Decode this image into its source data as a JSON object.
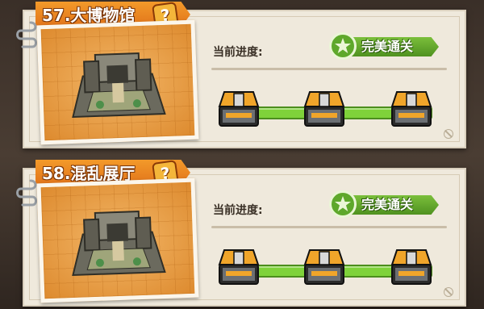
{
  "levels": [
    {
      "title": "57.大博物馆",
      "help_symbol": "?",
      "progress_label": "当前进度:",
      "status_badge": "完美通关",
      "chests": [
        "chest-1",
        "chest-2",
        "chest-3"
      ],
      "progress": 1.0
    },
    {
      "title": "58.混乱展厅",
      "help_symbol": "?",
      "progress_label": "当前进度:",
      "status_badge": "完美通关",
      "chests": [
        "chest-1",
        "chest-2",
        "chest-3"
      ],
      "progress": 1.0
    }
  ],
  "colors": {
    "title_tag": "#e1731a",
    "badge_green": "#5ea82b",
    "progress_fill": "#7fd23a",
    "card_bg": "#efe9dc"
  },
  "icons": {
    "help": "question-mark-icon",
    "badge": "star-icon",
    "chest": "treasure-chest-icon",
    "forbid": "forbidden-icon",
    "clip": "paperclip-icon"
  }
}
